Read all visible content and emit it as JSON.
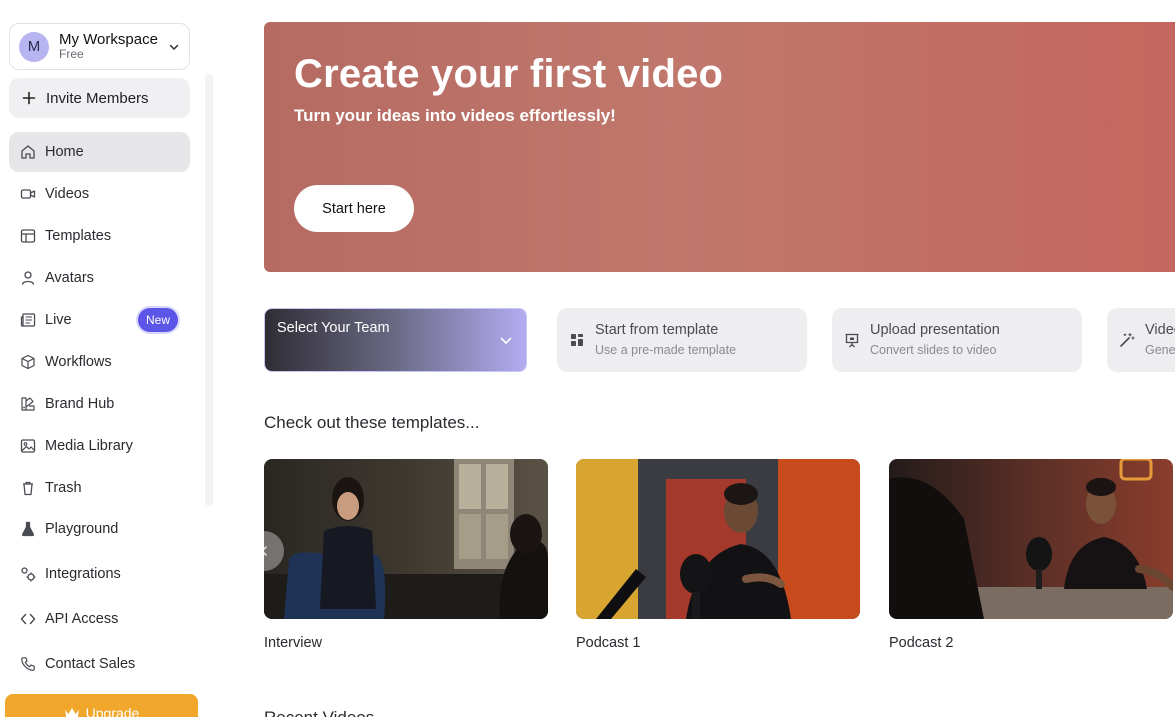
{
  "workspace": {
    "avatar_letter": "M",
    "name": "My Workspace",
    "plan": "Free"
  },
  "invite": {
    "label": "Invite Members"
  },
  "nav": [
    {
      "label": "Home",
      "icon": "home-icon",
      "active": true
    },
    {
      "label": "Videos",
      "icon": "video-camera-icon"
    },
    {
      "label": "Templates",
      "icon": "layout-icon"
    },
    {
      "label": "Avatars",
      "icon": "user-icon"
    },
    {
      "label": "Live",
      "icon": "newspaper-icon",
      "badge": "New"
    },
    {
      "label": "Workflows",
      "icon": "cube-icon"
    },
    {
      "label": "Brand Hub",
      "icon": "brand-kit-icon"
    },
    {
      "label": "Media Library",
      "icon": "image-icon"
    },
    {
      "label": "Trash",
      "icon": "trash-icon"
    },
    {
      "label": "Playground",
      "icon": "flask-icon"
    },
    {
      "label": "Integrations",
      "icon": "integrations-icon"
    },
    {
      "label": "API Access",
      "icon": "code-icon"
    },
    {
      "label": "Contact Sales",
      "icon": "phone-icon"
    }
  ],
  "upgrade": {
    "label": "Upgrade",
    "icon": "crown-icon"
  },
  "hero": {
    "title": "Create your first video",
    "subtitle": "Turn your ideas into videos effortlessly!",
    "button": "Start here"
  },
  "team_select": {
    "label": "Select Your Team"
  },
  "actions": [
    {
      "title": "Start from template",
      "subtitle": "Use a pre-made template",
      "icon": "template-icon"
    },
    {
      "title": "Upload presentation",
      "subtitle": "Convert slides to video",
      "icon": "presentation-icon"
    },
    {
      "title": "Video",
      "subtitle": "Gene",
      "icon": "magic-wand-icon"
    }
  ],
  "templates_section": {
    "title": "Check out these templates..."
  },
  "templates": [
    {
      "name": "Interview"
    },
    {
      "name": "Podcast 1"
    },
    {
      "name": "Podcast 2"
    }
  ],
  "recent_section": {
    "title": "Recent Videos"
  },
  "colors": {
    "accent": "#5b55e8",
    "upgrade": "#f0a72b",
    "hero": "#c0776c"
  }
}
